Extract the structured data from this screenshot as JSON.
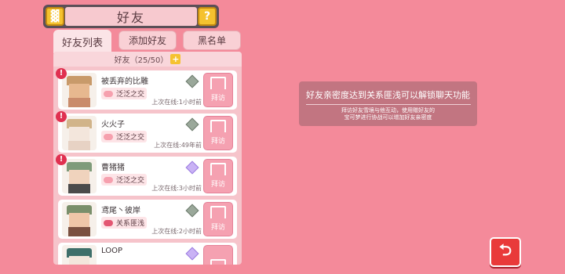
{
  "header": {
    "title": "好友",
    "left_icon": "friends-icon",
    "right_icon": "help-icon",
    "help_glyph": "?"
  },
  "tabs": [
    {
      "label": "好友列表",
      "active": true
    },
    {
      "label": "添加好友",
      "active": false
    },
    {
      "label": "黑名单",
      "active": false
    }
  ],
  "friends_count": "好友（25/50）",
  "friends": [
    {
      "name": "被丢弃的比雕",
      "relation": "泛泛之交",
      "last_online": "上次在线:1小时前",
      "visit": "拜访",
      "gem": "green"
    },
    {
      "name": "火火子",
      "relation": "泛泛之交",
      "last_online": "上次在线:49年前",
      "visit": "拜访",
      "gem": "green"
    },
    {
      "name": "曹猪猪",
      "relation": "泛泛之交",
      "last_online": "上次在线:3小时前",
      "visit": "拜访",
      "gem": "purple"
    },
    {
      "name": "鸢尾丶彼岸",
      "relation": "关系匪浅",
      "last_online": "上次在线:2小时前",
      "visit": "拜访",
      "gem": "green"
    },
    {
      "name": "LOOP",
      "relation": "",
      "last_online": "",
      "visit": "",
      "gem": "purple"
    }
  ],
  "info": {
    "title": "好友亲密度达到关系匪浅可以解锁聊天功能",
    "line1": "拜访好友雪境与他互动，使用赠好友的",
    "line2": "宝可梦进行协战可以增加好友亲密度"
  },
  "back_glyph": "⮌"
}
